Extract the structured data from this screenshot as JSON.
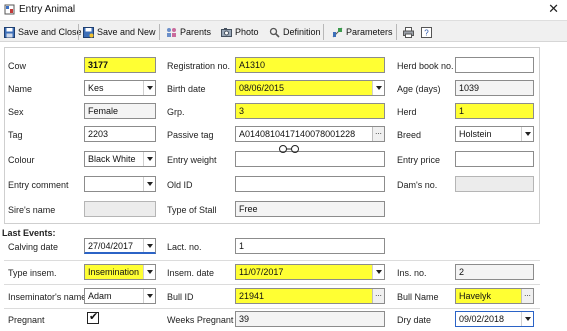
{
  "window": {
    "title": "Entry Animal",
    "close_glyph": "✕"
  },
  "toolbar": {
    "save_close": "Save and Close",
    "save_new": "Save and New",
    "parents": "Parents",
    "photo": "Photo",
    "definition": "Definition",
    "parameters": "Parameters"
  },
  "animal": {
    "cow_label": "Cow",
    "cow_value": "3177",
    "name_label": "Name",
    "name_value": "Kes",
    "sex_label": "Sex",
    "sex_value": "Female",
    "tag_label": "Tag",
    "tag_value": "2203",
    "colour_label": "Colour",
    "colour_value": "Black White",
    "entry_comment_label": "Entry comment",
    "entry_comment_value": "",
    "sire_label": "Sire's name",
    "sire_value": "",
    "registration_label": "Registration no.",
    "registration_value": "A1310",
    "birth_label": "Birth date",
    "birth_value": "08/06/2015",
    "grp_label": "Grp.",
    "grp_value": "3",
    "passive_tag_label": "Passive tag",
    "passive_tag_value": "A01408104171400780012​28",
    "entry_weight_label": "Entry weight",
    "entry_weight_value": "",
    "old_id_label": "Old ID",
    "old_id_value": "",
    "stall_label": "Type of Stall",
    "stall_value": "Free",
    "herd_book_label": "Herd book no.",
    "herd_book_value": "",
    "age_label": "Age (days)",
    "age_value": "1039",
    "herd_label": "Herd",
    "herd_value": "1",
    "breed_label": "Breed",
    "breed_value": "Holstein",
    "entry_price_label": "Entry price",
    "entry_price_value": "",
    "dam_label": "Dam's no.",
    "dam_value": ""
  },
  "last_events": {
    "heading": "Last Events:",
    "calving_label": "Calving date",
    "calving_value": "27/04/2017",
    "type_insem_label": "Type insem.",
    "type_insem_value": "Insemination",
    "inseminator_label": "Inseminator's name",
    "inseminator_value": "Adam",
    "pregnant_label": "Pregnant",
    "pregnant_checked": "✔",
    "lact_label": "Lact. no.",
    "lact_value": "1",
    "insem_date_label": "Insem. date",
    "insem_date_value": "11/07/2017",
    "bull_id_label": "Bull ID",
    "bull_id_value": "21941",
    "weeks_label": "Weeks Pregnant",
    "weeks_value": "39",
    "ins_no_label": "Ins. no.",
    "ins_no_value": "2",
    "bull_name_label": "Bull Name",
    "bull_name_value": "Havelyk",
    "dry_label": "Dry date",
    "dry_value": "09/02/2018"
  },
  "colors": {
    "highlight": "#ffff33",
    "toolbar_bg": "#f0f0f0"
  }
}
